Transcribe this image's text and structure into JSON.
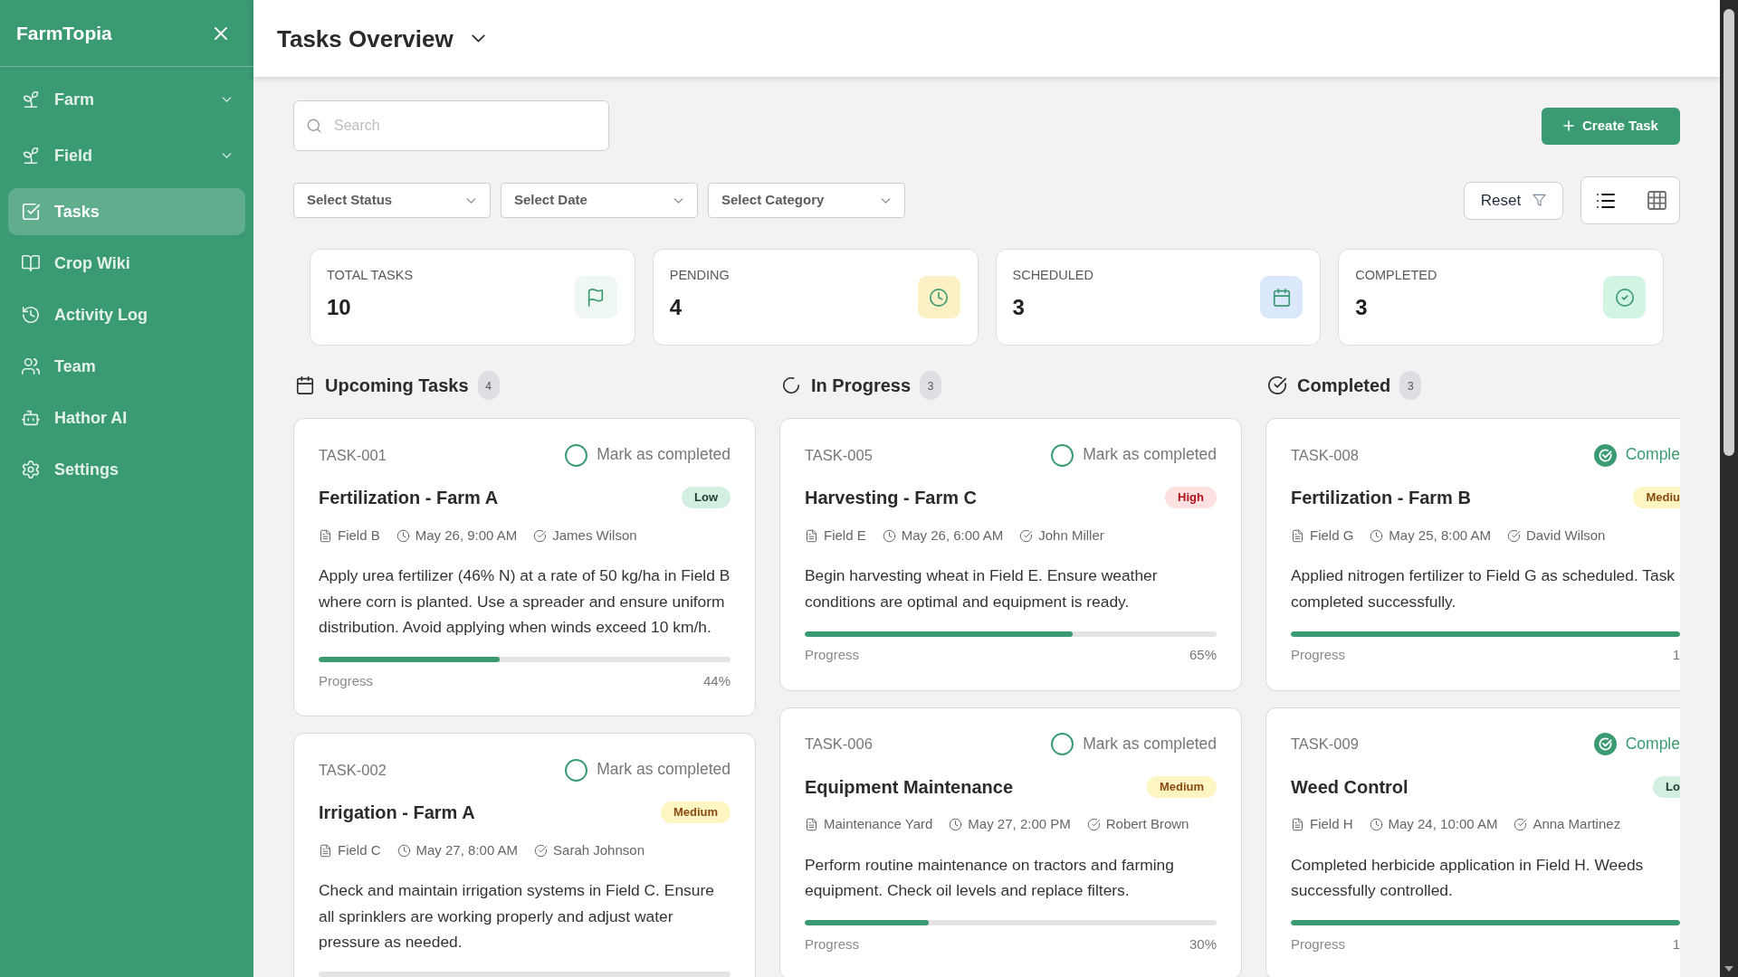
{
  "sidebar": {
    "brand": "FarmTopia",
    "items": [
      {
        "label": "Farm",
        "kind": "group",
        "expanded": false,
        "selected": false
      },
      {
        "label": "Field",
        "kind": "group",
        "expanded": false,
        "selected": false
      },
      {
        "label": "Tasks",
        "kind": "link",
        "selected": true
      },
      {
        "label": "Crop Wiki",
        "kind": "link",
        "selected": false
      },
      {
        "label": "Activity Log",
        "kind": "link",
        "selected": false
      },
      {
        "label": "Team",
        "kind": "link",
        "selected": false
      },
      {
        "label": "Hathor AI",
        "kind": "link",
        "selected": false
      },
      {
        "label": "Settings",
        "kind": "link",
        "selected": false
      }
    ]
  },
  "header": {
    "title": "Tasks Overview"
  },
  "toolbar": {
    "search": {
      "placeholder": "Search"
    },
    "create_button": "Create Task",
    "filters": [
      "Select Status",
      "Select Date",
      "Select Category"
    ],
    "reset_button": "Reset",
    "view_options": [
      {
        "kind": "list",
        "selected": true
      },
      {
        "kind": "grid",
        "selected": false
      }
    ]
  },
  "stats": [
    {
      "label": "TOTAL TASKS",
      "value": "10"
    },
    {
      "label": "PENDING",
      "value": "4"
    },
    {
      "label": "SCHEDULED",
      "value": "3"
    },
    {
      "label": "COMPLETED",
      "value": "3"
    }
  ],
  "columns": [
    {
      "title": "Upcoming Tasks",
      "count": "4",
      "tasks": [
        {
          "id": "TASK-001",
          "action": "Mark as completed",
          "completed": false,
          "title": "Fertilization - Farm A",
          "badge": {
            "text": "Low",
            "kind": "low"
          },
          "location": "Field B",
          "due": "May 26, 9:00 AM",
          "assignee": "James Wilson",
          "description": "Apply urea fertilizer (46% N) at a rate of 50 kg/ha in Field B where corn is planted. Use a spreader and ensure uniform distribution. Avoid applying when winds exceed 10 km/h.",
          "progress": {
            "label": "Progress",
            "level": 0.44,
            "percent": "44%"
          }
        },
        {
          "id": "TASK-002",
          "action": "Mark as completed",
          "completed": false,
          "title": "Irrigation - Farm A",
          "badge": {
            "text": "Medium",
            "kind": "medium"
          },
          "location": "Field C",
          "due": "May 27, 8:00 AM",
          "assignee": "Sarah Johnson",
          "description": "Check and maintain irrigation systems in Field C. Ensure all sprinklers are working properly and adjust water pressure as needed.",
          "progress": {
            "level": 0
          }
        }
      ]
    },
    {
      "title": "In Progress",
      "count": "3",
      "tasks": [
        {
          "id": "TASK-005",
          "action": "Mark as completed",
          "completed": false,
          "title": "Harvesting - Farm C",
          "badge": {
            "text": "High",
            "kind": "high"
          },
          "location": "Field E",
          "due": "May 26, 6:00 AM",
          "assignee": "John Miller",
          "description": "Begin harvesting wheat in Field E. Ensure weather conditions are optimal and equipment is ready.",
          "progress": {
            "label": "Progress",
            "level": 0.65,
            "percent": "65%"
          }
        },
        {
          "id": "TASK-006",
          "action": "Mark as completed",
          "completed": false,
          "title": "Equipment Maintenance",
          "badge": {
            "text": "Medium",
            "kind": "medium"
          },
          "location": "Maintenance Yard",
          "due": "May 27, 2:00 PM",
          "assignee": "Robert Brown",
          "description": "Perform routine maintenance on tractors and farming equipment. Check oil levels and replace filters.",
          "progress": {
            "label": "Progress",
            "level": 0.3,
            "percent": "30%"
          }
        }
      ]
    },
    {
      "title": "Completed",
      "count": "3",
      "tasks": [
        {
          "id": "TASK-008",
          "action": "Comple",
          "completed": true,
          "title": "Fertilization - Farm B",
          "badge": {
            "text": "Mediu",
            "kind": "medium"
          },
          "location": "Field G",
          "due": "May 25, 8:00 AM",
          "assignee": "David Wilson",
          "description": "Applied nitrogen fertilizer to Field G as scheduled. Task completed successfully.",
          "progress": {
            "label": "Progress",
            "level": 1,
            "percent": "1"
          }
        },
        {
          "id": "TASK-009",
          "action": "Comple",
          "completed": true,
          "title": "Weed Control",
          "badge": {
            "text": "Lo",
            "kind": "low"
          },
          "location": "Field H",
          "due": "May 24, 10:00 AM",
          "assignee": "Anna Martinez",
          "description": "Completed herbicide application in Field H. Weeds successfully controlled.",
          "progress": {
            "label": "Progress",
            "level": 1,
            "percent": "1"
          }
        }
      ]
    }
  ]
}
